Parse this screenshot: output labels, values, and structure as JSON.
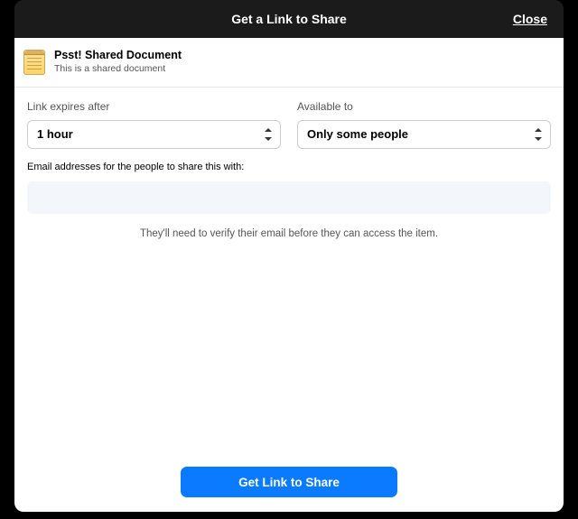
{
  "dialog": {
    "title": "Get a Link to Share",
    "close_label": "Close"
  },
  "document": {
    "name": "Psst! Shared Document",
    "subtitle": "This is a shared document"
  },
  "fields": {
    "expires": {
      "label": "Link expires after",
      "value": "1 hour"
    },
    "available": {
      "label": "Available to",
      "value": "Only some people"
    },
    "emails": {
      "label": "Email addresses for the people to share this with:",
      "value": "",
      "hint": "They'll need to verify their email before they can access the item."
    }
  },
  "footer": {
    "primary_label": "Get Link to Share"
  }
}
